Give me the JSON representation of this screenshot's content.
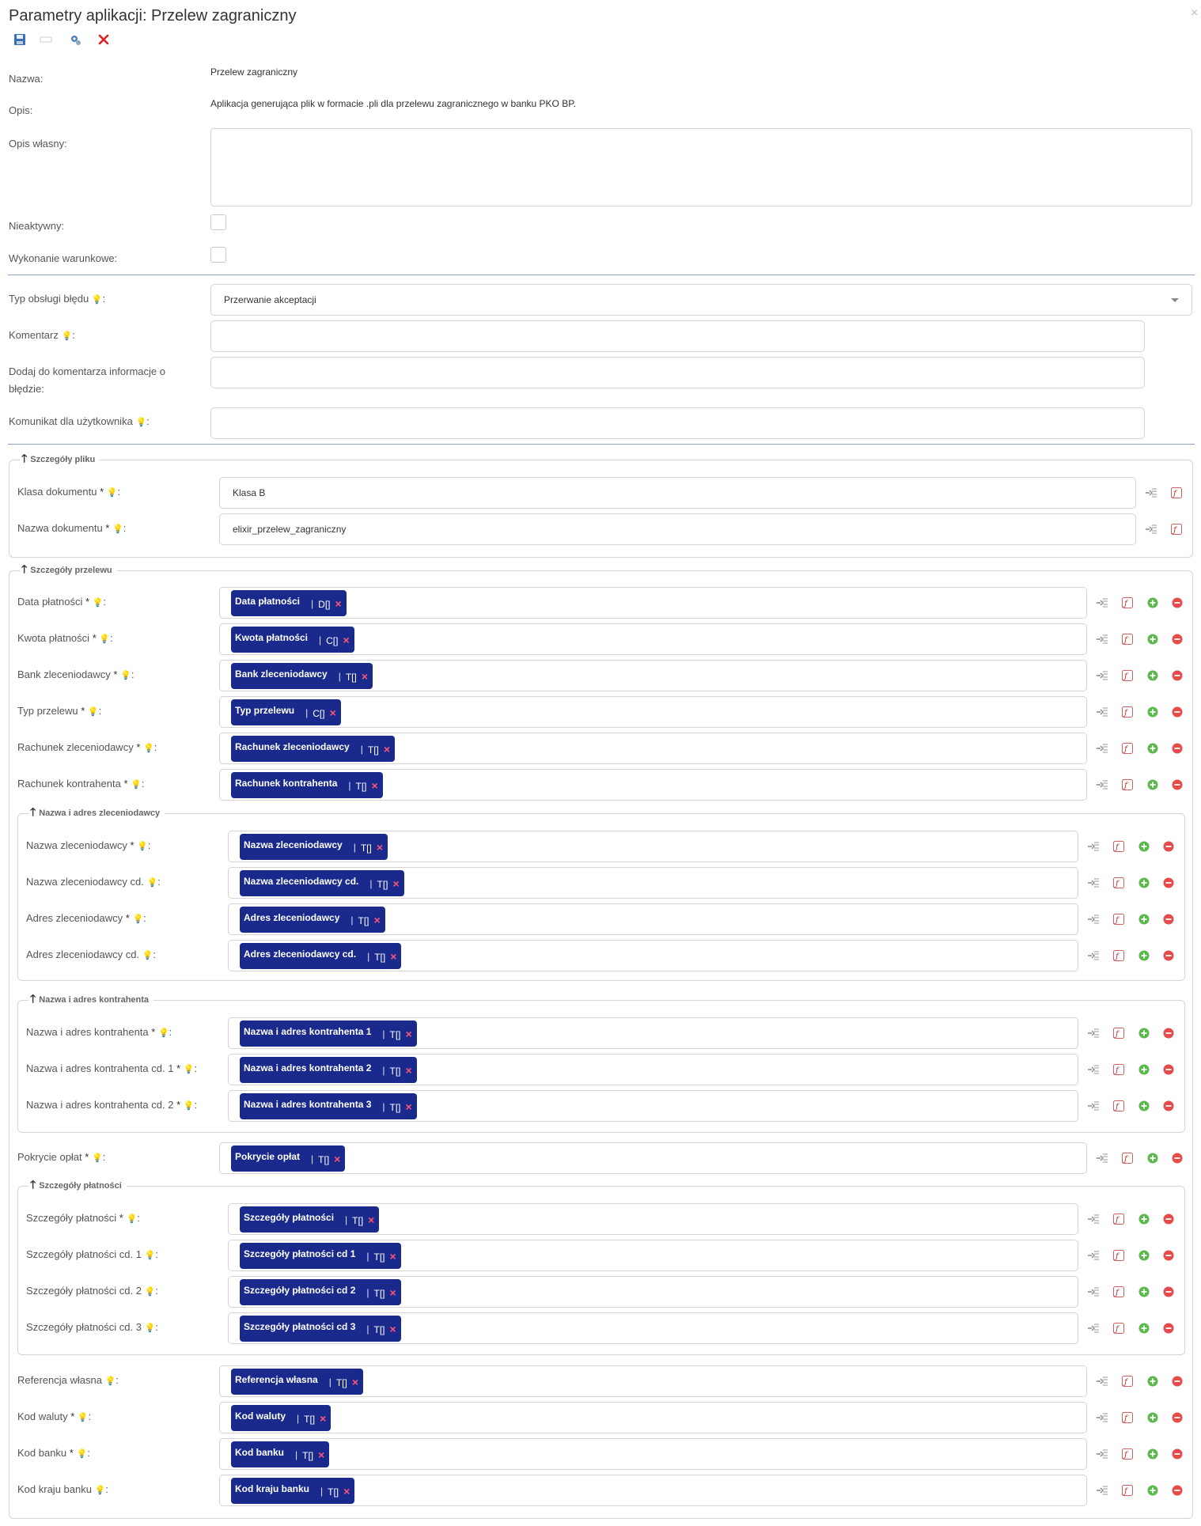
{
  "title": "Parametry aplikacji: Przelew zagraniczny",
  "close_glyph": "×",
  "toolbar": [
    {
      "name": "save-icon"
    },
    {
      "name": "disabled-button-icon"
    },
    {
      "name": "settings-gear-icon"
    },
    {
      "name": "delete-icon"
    }
  ],
  "top": {
    "nazwa_label": "Nazwa:",
    "nazwa_value": "Przelew zagraniczny",
    "opis_label": "Opis:",
    "opis_value": "Aplikacja generująca plik w formacie .pli dla przelewu zagranicznego w banku PKO BP.",
    "opis_wlasny_label": "Opis własny:",
    "opis_wlasny_value": "",
    "nieaktywny_label": "Nieaktywny:",
    "nieaktywny_checked": false,
    "wykonanie_label": "Wykonanie warunkowe:",
    "wykonanie_checked": false
  },
  "error": {
    "typ_label": "Typ obsługi błędu",
    "typ_value": "Przerwanie akceptacji",
    "komentarz_label": "Komentarz",
    "komentarz_value": "",
    "dodaj_label_1": "Dodaj do komentarza informacje o",
    "dodaj_label_2": "błędzie:",
    "dodaj_value": "",
    "komunikat_label": "Komunikat dla użytkownika",
    "komunikat_value": ""
  },
  "hint_glyph": "💡",
  "colon": ":",
  "req_mark": "*",
  "chip_sep": "|",
  "chip_remove": "×",
  "legend_arrow": "🡑",
  "plik": {
    "legend": "Szczegóły pliku",
    "rows": [
      {
        "label": "Klasa dokumentu",
        "value": "Klasa B"
      },
      {
        "label": "Nazwa dokumentu",
        "value": "elixir_przelew_zagraniczny"
      }
    ]
  },
  "przelew": {
    "legend": "Szczegóły przelewu",
    "rows": [
      {
        "label": "Data płatności",
        "chip": "Data płatności",
        "type": "D[]"
      },
      {
        "label": "Kwota płatności",
        "chip": "Kwota płatności",
        "type": "C[]"
      },
      {
        "label": "Bank zleceniodawcy",
        "chip": "Bank zleceniodawcy",
        "type": "T[]"
      },
      {
        "label": "Typ przelewu",
        "chip": "Typ przelewu",
        "type": "C[]"
      },
      {
        "label": "Rachunek zleceniodawcy",
        "chip": "Rachunek zleceniodawcy",
        "type": "T[]"
      },
      {
        "label": "Rachunek kontrahenta",
        "chip": "Rachunek kontrahenta",
        "type": "T[]"
      }
    ],
    "zlec": {
      "legend": "Nazwa i adres zleceniodawcy",
      "rows": [
        {
          "label": "Nazwa zleceniodawcy",
          "req": true,
          "chip": "Nazwa zleceniodawcy",
          "type": "T[]"
        },
        {
          "label": "Nazwa zleceniodawcy cd.",
          "req": false,
          "chip": "Nazwa zleceniodawcy cd.",
          "type": "T[]"
        },
        {
          "label": "Adres zleceniodawcy",
          "req": true,
          "chip": "Adres zleceniodawcy",
          "type": "T[]"
        },
        {
          "label": "Adres zleceniodawcy cd.",
          "req": false,
          "chip": "Adres zleceniodawcy cd.",
          "type": "T[]"
        }
      ]
    },
    "kontr": {
      "legend": "Nazwa i adres kontrahenta",
      "rows": [
        {
          "label": "Nazwa i adres kontrahenta",
          "chip": "Nazwa i adres kontrahenta 1",
          "type": "T[]"
        },
        {
          "label": "Nazwa i adres kontrahenta cd. 1",
          "chip": "Nazwa i adres kontrahenta 2",
          "type": "T[]"
        },
        {
          "label": "Nazwa i adres kontrahenta cd. 2",
          "chip": "Nazwa i adres kontrahenta 3",
          "type": "T[]"
        }
      ]
    },
    "pokrycie": {
      "label": "Pokrycie opłat",
      "chip": "Pokrycie opłat",
      "type": "T[]"
    },
    "platnosci": {
      "legend": "Szczegóły płatności",
      "rows": [
        {
          "label": "Szczegóły płatności",
          "req": true,
          "chip": "Szczegóły płatności",
          "type": "T[]"
        },
        {
          "label": "Szczegóły płatności cd. 1",
          "req": false,
          "chip": "Szczegóły płatności cd 1",
          "type": "T[]"
        },
        {
          "label": "Szczegóły płatności cd. 2",
          "req": false,
          "chip": "Szczegóły płatności cd 2",
          "type": "T[]"
        },
        {
          "label": "Szczegóły płatności cd. 3",
          "req": false,
          "chip": "Szczegóły płatności cd 3",
          "type": "T[]"
        }
      ]
    },
    "bottom": [
      {
        "label": "Referencja własna",
        "req": false,
        "chip": "Referencja własna",
        "type": "T[]"
      },
      {
        "label": "Kod waluty",
        "req": true,
        "chip": "Kod waluty",
        "type": "T[]"
      },
      {
        "label": "Kod banku",
        "req": true,
        "chip": "Kod banku",
        "type": "T[]"
      },
      {
        "label": "Kod kraju banku",
        "req": false,
        "chip": "Kod kraju banku",
        "type": "T[]"
      }
    ]
  }
}
